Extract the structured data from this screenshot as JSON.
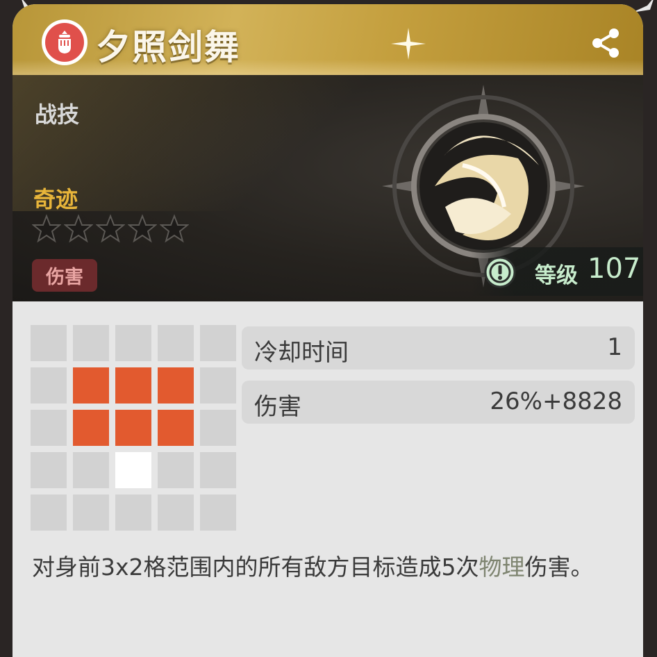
{
  "skill": {
    "name": "夕照剑舞",
    "type": "战技",
    "rarity": "奇迹",
    "stars_filled": 0,
    "stars_total": 5,
    "tag": "伤害",
    "level_label": "等级",
    "level_value": "107"
  },
  "range": {
    "rows": [
      [
        "empty",
        "empty",
        "empty",
        "empty",
        "empty"
      ],
      [
        "empty",
        "hit",
        "hit",
        "hit",
        "empty"
      ],
      [
        "empty",
        "hit",
        "hit",
        "hit",
        "empty"
      ],
      [
        "empty",
        "empty",
        "self",
        "empty",
        "empty"
      ],
      [
        "empty",
        "empty",
        "empty",
        "empty",
        "empty"
      ]
    ]
  },
  "stats": [
    {
      "label": "冷却时间",
      "value": "1"
    },
    {
      "label": "伤害",
      "value": "26%+8828"
    }
  ],
  "description": {
    "before": "对身前3x2格范围内的所有敌方目标造成5次",
    "highlight": "物理",
    "after": "伤害。"
  },
  "colors": {
    "hit_cell": "#e25a2f",
    "self_cell": "#ffffff",
    "empty_cell": "#d2d2d2"
  },
  "icons": {
    "badge": "fist-emblem-icon",
    "share": "share-icon",
    "sparkle": "sparkle-icon",
    "skill": "sword-slash-icon",
    "level": "exclamation-icon",
    "star": "star-outline-icon"
  }
}
